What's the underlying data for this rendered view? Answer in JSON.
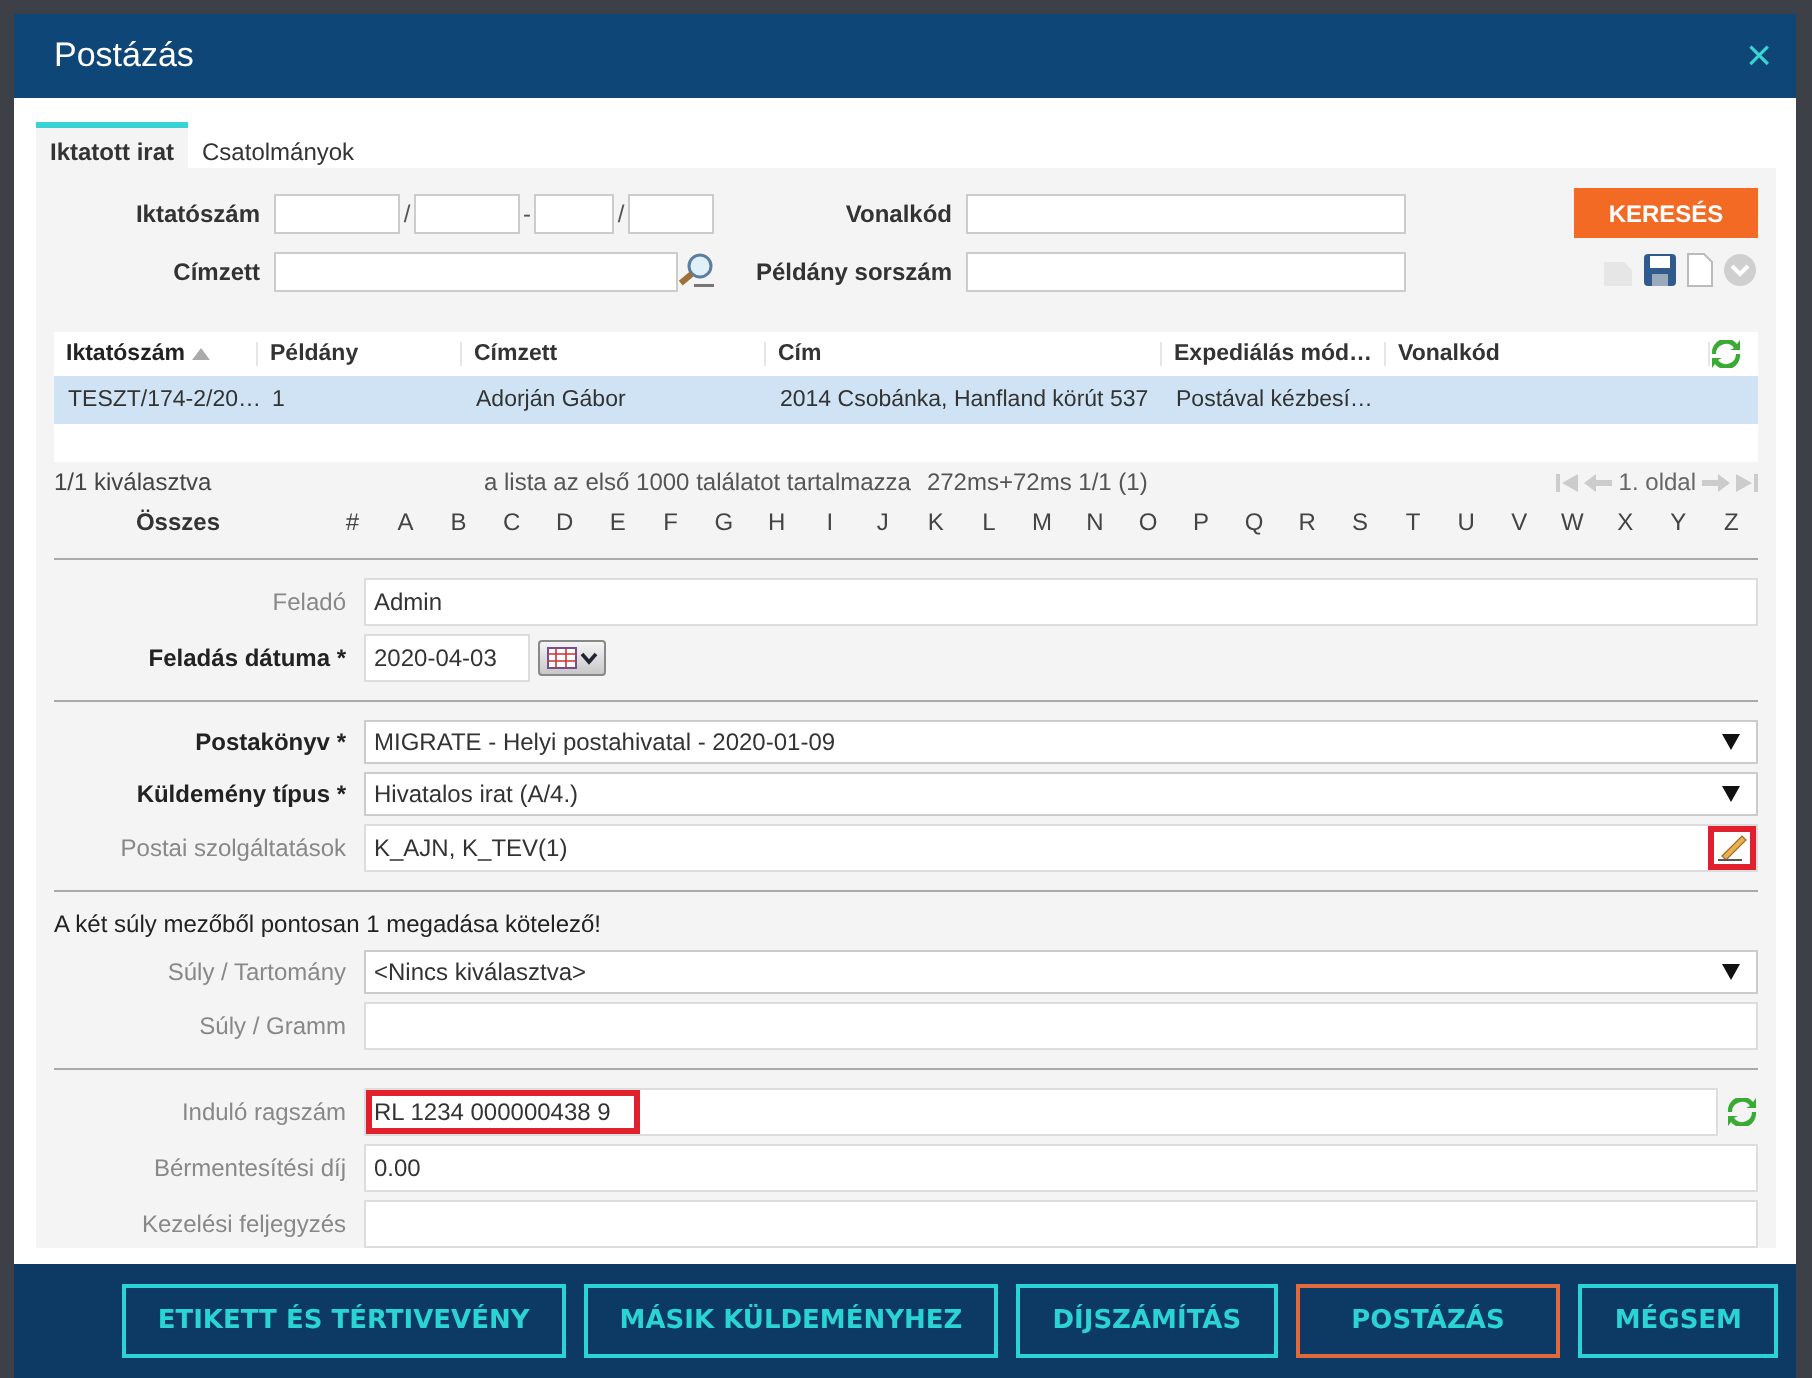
{
  "dialog": {
    "title": "Postázás",
    "close": "×"
  },
  "tabs": [
    {
      "label": "Iktatott irat",
      "selected": true
    },
    {
      "label": "Csatolmányok",
      "selected": false
    }
  ],
  "search": {
    "iktatoszam_label": "Iktatószám",
    "separators": [
      "/",
      "-",
      "/"
    ],
    "cimzett_label": "Címzett",
    "vonalkod_label": "Vonalkód",
    "peldany_label": "Példány sorszám",
    "button": "KERESÉS"
  },
  "table": {
    "columns": [
      {
        "label": "Iktatószám",
        "sorted": true
      },
      {
        "label": "Példány",
        "sorted": false
      },
      {
        "label": "Címzett",
        "sorted": false
      },
      {
        "label": "Cím",
        "sorted": false
      },
      {
        "label": "Expediálás mód…",
        "sorted": false
      },
      {
        "label": "Vonalkód",
        "sorted": false
      }
    ],
    "rows": [
      {
        "cells": [
          "TESZT/174-2/20…",
          "1",
          "Adorján Gábor",
          "2014 Csobánka, Hanfland körút 537",
          "Postával kézbesí…",
          ""
        ],
        "selected": true
      }
    ]
  },
  "status": {
    "selection": "1/1 kiválasztva",
    "info": "a lista az első 1000 találatot tartalmazza",
    "timing": "272ms+72ms 1/1 (1)",
    "page": "1. oldal"
  },
  "alphabet": {
    "all": "Összes",
    "letters": [
      "#",
      "A",
      "B",
      "C",
      "D",
      "E",
      "F",
      "G",
      "H",
      "I",
      "J",
      "K",
      "L",
      "M",
      "N",
      "O",
      "P",
      "Q",
      "R",
      "S",
      "T",
      "U",
      "V",
      "W",
      "X",
      "Y",
      "Z"
    ]
  },
  "sections": [
    {
      "fields": [
        {
          "kind": "text",
          "label": "Feladó",
          "required": false,
          "value": "Admin",
          "highlighted": false
        },
        {
          "kind": "date",
          "label": "Feladás dátuma *",
          "required": true,
          "value": "2020-04-03",
          "highlighted": false
        }
      ]
    },
    {
      "fields": [
        {
          "kind": "select",
          "label": "Postakönyv *",
          "required": true,
          "value": "MIGRATE - Helyi postahivatal - 2020-01-09",
          "highlighted": false
        },
        {
          "kind": "select",
          "label": "Küldemény típus *",
          "required": true,
          "value": "Hivatalos irat (A/4.)",
          "highlighted": false
        },
        {
          "kind": "service",
          "label": "Postai szolgáltatások",
          "required": false,
          "value": "K_AJN, K_TEV(1)",
          "highlighted": true
        }
      ]
    },
    {
      "note": "A két súly mezőből pontosan 1 megadása kötelező!",
      "fields": [
        {
          "kind": "select",
          "label": "Súly / Tartomány",
          "required": false,
          "value": "<Nincs kiválasztva>",
          "highlighted": false
        },
        {
          "kind": "text",
          "label": "Súly / Gramm",
          "required": false,
          "highlighted": false
        }
      ]
    },
    {
      "fields": [
        {
          "kind": "refresh",
          "label": "Induló ragszám",
          "required": false,
          "value": "RL 1234 000000438 9",
          "highlighted": true
        },
        {
          "kind": "text",
          "label": "Bérmentesítési díj",
          "required": false,
          "value": "0.00",
          "highlighted": false
        },
        {
          "kind": "text",
          "label": "Kezelési feljegyzés",
          "required": false,
          "highlighted": false
        }
      ]
    }
  ],
  "buttons": [
    {
      "label": "ETIKETT ÉS TÉRTIVEVÉNY",
      "primary": false
    },
    {
      "label": "MÁSIK KÜLDEMÉNYHEZ",
      "primary": false
    },
    {
      "label": "DÍJSZÁMÍTÁS",
      "primary": false
    },
    {
      "label": "POSTÁZÁS",
      "primary": true
    },
    {
      "label": "MÉGSEM",
      "primary": false
    }
  ]
}
